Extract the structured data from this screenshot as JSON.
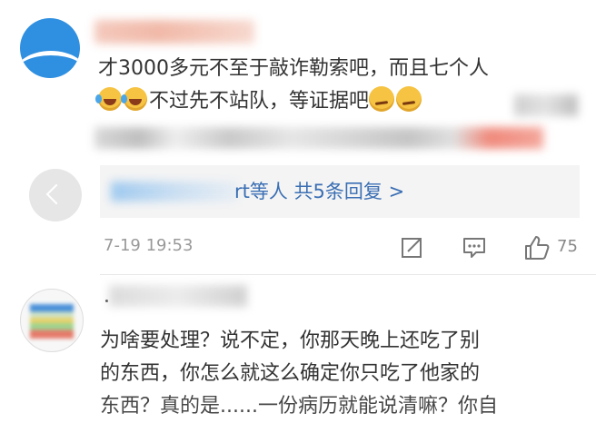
{
  "comment1": {
    "text_line1": "才3000多元不至于敲诈勒索吧，而且七个人",
    "text_line2": "不过先不站队，等证据吧"
  },
  "replies": {
    "label": "rt等人 共5条回复 >"
  },
  "meta": {
    "timestamp": "7-19 19:53",
    "like_count": "75"
  },
  "comment2": {
    "line1": "为啥要处理？说不定，你那天晚上还吃了别",
    "line2": "的东西，你怎么就这么确定你只吃了他家的",
    "line3": "东西？真的是......一份病历就能说清嘛？你自"
  },
  "icons": [
    "share-icon",
    "comment-icon",
    "like-icon",
    "laugh-cry-icon",
    "smirk-icon",
    "back-chevron-icon"
  ]
}
